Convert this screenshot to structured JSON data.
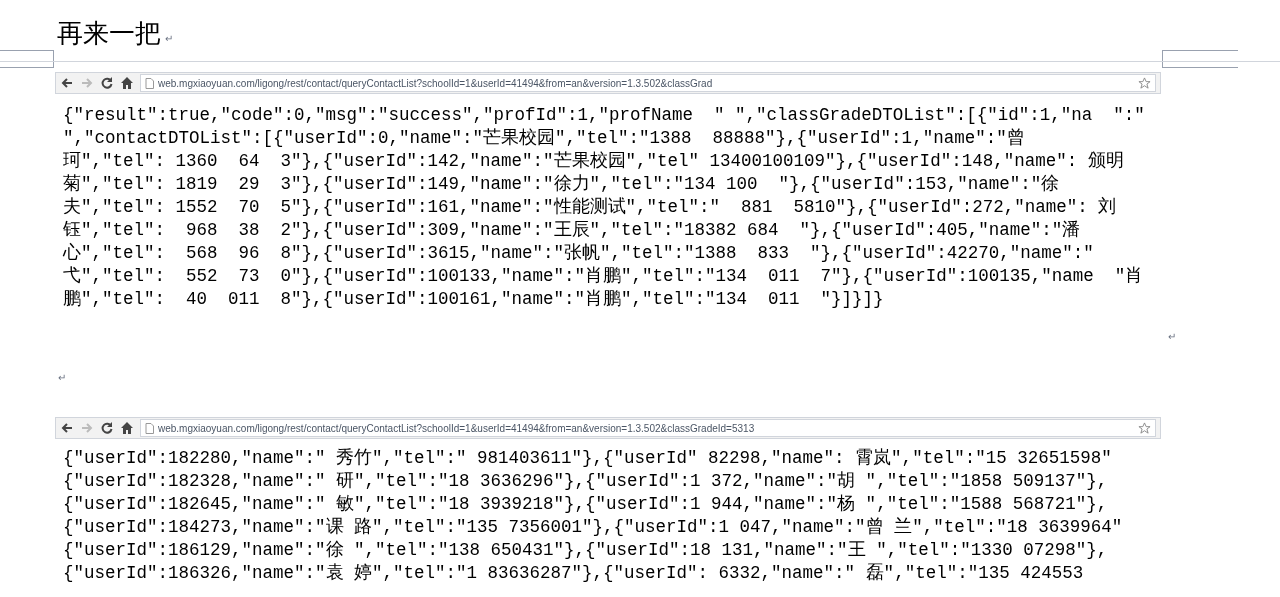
{
  "document": {
    "heading": "再来一把",
    "heading_mark": "↵",
    "screenshots": [
      {
        "url": "web.mgxiaoyuan.com/ligong/rest/contact/queryContactList?schoolId=1&userId=41494&from=an&version=1.3.502&classGrad",
        "lines": [
          "{\"result\":true,\"code\":0,\"msg\":\"success\",\"profId\":1,\"profName  \" \",\"classGradeDTOList\":[{\"id\":1,\"na  \":\"",
          "\",\"contactDTOList\":[{\"userId\":0,\"name\":\"芒果校园\",\"tel\":\"1388  88888\"},{\"userId\":1,\"name\":\"曾",
          "珂\",\"tel\": 1360  64  3\"},{\"userId\":142,\"name\":\"芒果校园\",\"tel\" 13400100109\"},{\"userId\":148,\"name\": 颁明",
          "菊\",\"tel\": 1819  29  3\"},{\"userId\":149,\"name\":\"徐力\",\"tel\":\"134 100  \"},{\"userId\":153,\"name\":\"徐",
          "夫\",\"tel\": 1552  70  5\"},{\"userId\":161,\"name\":\"性能测试\",\"tel\":\"  881  5810\"},{\"userId\":272,\"name\": 刘",
          "钰\",\"tel\":  968  38  2\"},{\"userId\":309,\"name\":\"王辰\",\"tel\":\"18382 684  \"},{\"userId\":405,\"name\":\"潘",
          "心\",\"tel\":  568  96  8\"},{\"userId\":3615,\"name\":\"张帆\",\"tel\":\"1388  833  \"},{\"userId\":42270,\"name\":\"",
          "弋\",\"tel\":  552  73  0\"},{\"userId\":100133,\"name\":\"肖鹏\",\"tel\":\"134  011  7\"},{\"userId\":100135,\"name  \"肖",
          "鹏\",\"tel\":  40  011  8\"},{\"userId\":100161,\"name\":\"肖鹏\",\"tel\":\"134  011  \"}]}]}"
        ]
      },
      {
        "url": "web.mgxiaoyuan.com/ligong/rest/contact/queryContactList?schoolId=1&userId=41494&from=an&version=1.3.502&classGradeId=5313",
        "lines": [
          "{\"userId\":182280,\"name\":\" 秀竹\",\"tel\":\" 981403611\"},{\"userId\" 82298,\"name\": 霄岚\",\"tel\":\"15 32651598\"",
          "{\"userId\":182328,\"name\":\" 研\",\"tel\":\"18 3636296\"},{\"userId\":1 372,\"name\":\"胡 \",\"tel\":\"1858 509137\"},",
          "{\"userId\":182645,\"name\":\" 敏\",\"tel\":\"18 3939218\"},{\"userId\":1 944,\"name\":\"杨 \",\"tel\":\"1588 568721\"},",
          "{\"userId\":184273,\"name\":\"课 路\",\"tel\":\"135 7356001\"},{\"userId\":1 047,\"name\":\"曾 兰\",\"tel\":\"18 3639964\"",
          "{\"userId\":186129,\"name\":\"徐 \",\"tel\":\"138 650431\"},{\"userId\":18 131,\"name\":\"王 \",\"tel\":\"1330 07298\"},",
          "{\"userId\":186326,\"name\":\"袁 婷\",\"tel\":\"1 83636287\"},{\"userId\": 6332,\"name\":\" 磊\",\"tel\":\"135 424553"
        ]
      }
    ],
    "paragraph_marks": [
      "↵",
      "↵"
    ]
  }
}
